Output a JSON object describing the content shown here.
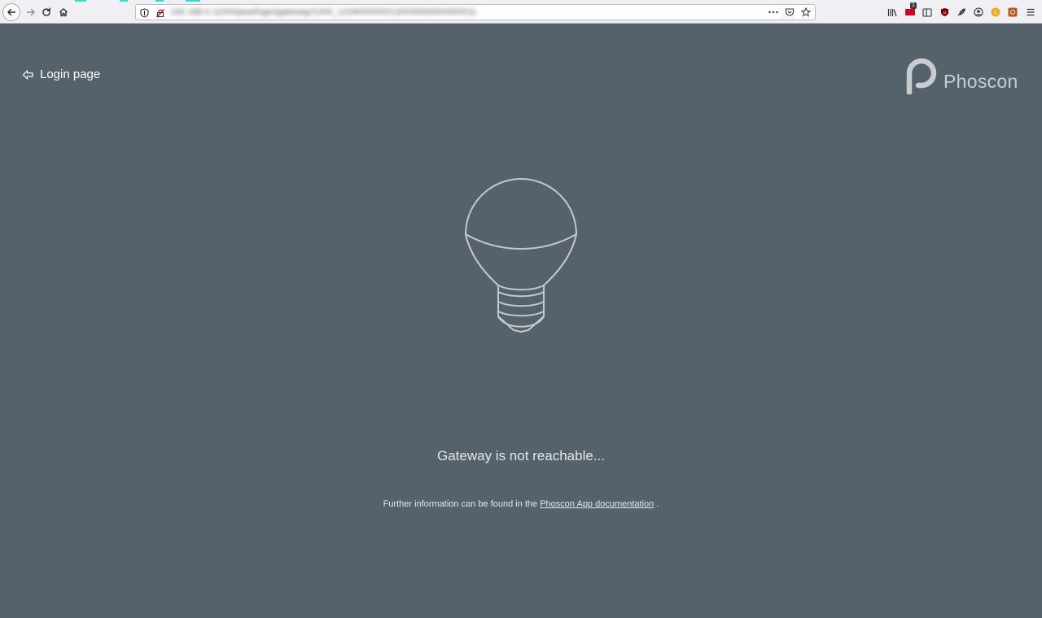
{
  "browser": {
    "url_blurred": "192.168.0.115/#/pwa/login/gateway/13/4/_1234/0/0/0/0/13/0/00/00/00/00/0/11",
    "icons": {
      "back": "arrow-left-icon",
      "forward": "arrow-right-icon",
      "reload": "reload-icon",
      "home": "home-icon",
      "tracking": "shield-icon",
      "insecure": "insecure-lock-icon",
      "page_actions": "more-dots-icon",
      "pocket": "pocket-icon",
      "bookmark": "star-icon",
      "library": "library-icon",
      "sidebar": "sidebar-icon",
      "menu": "hamburger-icon"
    },
    "extension_badge": "1"
  },
  "page": {
    "back_link_label": "Login page",
    "brand_name": "Phoscon",
    "status_heading": "Gateway is not reachable...",
    "info_prefix": "Further information can be found in the ",
    "info_link": "Phoscon App documentation",
    "info_suffix": " ."
  },
  "colors": {
    "background": "#56626b",
    "chrome": "#f0f0f4",
    "text": "#e4e7e9",
    "bulb_stroke": "#c3c8cc",
    "brand": "#c8cdd1"
  }
}
